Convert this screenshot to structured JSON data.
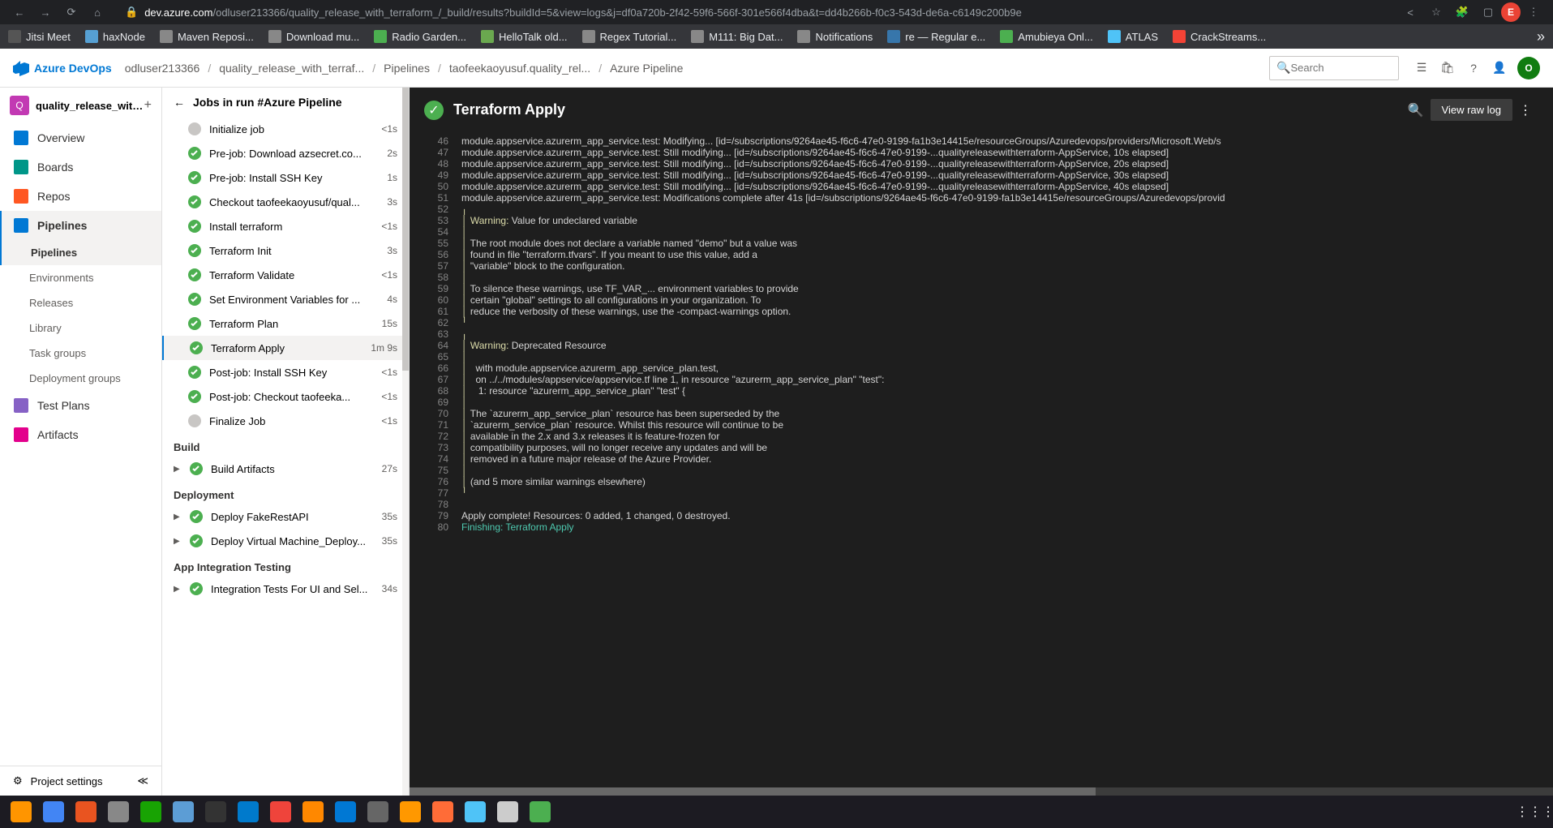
{
  "browser": {
    "url_host": "dev.azure.com",
    "url_path": "/odluser213366/quality_release_with_terraform_/_build/results?buildId=5&view=logs&j=df0a720b-2f42-59f6-566f-301e566f4dba&t=dd4b266b-f0c3-543d-de6a-c6149c200b9e",
    "avatar_letter": "E"
  },
  "bookmarks": [
    {
      "label": "Jitsi Meet",
      "color": "#555"
    },
    {
      "label": "haxNode",
      "color": "#56a0d3"
    },
    {
      "label": "Maven Reposi...",
      "color": "#888"
    },
    {
      "label": "Download mu...",
      "color": "#888"
    },
    {
      "label": "Radio Garden...",
      "color": "#4caf50"
    },
    {
      "label": "HelloTalk old...",
      "color": "#6aa84f"
    },
    {
      "label": "Regex Tutorial...",
      "color": "#888"
    },
    {
      "label": "M111: Big Dat...",
      "color": "#888"
    },
    {
      "label": "Notifications",
      "color": "#888"
    },
    {
      "label": "re — Regular e...",
      "color": "#3776ab"
    },
    {
      "label": "Amubieya Onl...",
      "color": "#4caf50"
    },
    {
      "label": "ATLAS",
      "color": "#4fc3f7"
    },
    {
      "label": "CrackStreams...",
      "color": "#f44336"
    }
  ],
  "azure": {
    "product": "Azure DevOps",
    "breadcrumbs": [
      "odluser213366",
      "quality_release_with_terraf...",
      "Pipelines",
      "taofeekaoyusuf.quality_rel...",
      "Azure Pipeline"
    ],
    "search_placeholder": "Search",
    "avatar_letter": "O"
  },
  "sidebar": {
    "project_name": "quality_release_with_t...",
    "items": [
      {
        "label": "Overview",
        "icon": "grid",
        "color": "#0078d4"
      },
      {
        "label": "Boards",
        "icon": "board",
        "color": "#009688"
      },
      {
        "label": "Repos",
        "icon": "repo",
        "color": "#ff5722"
      },
      {
        "label": "Pipelines",
        "icon": "pipeline",
        "color": "#0078d4",
        "active": true
      }
    ],
    "pipeline_subs": [
      {
        "label": "Pipelines",
        "active": true
      },
      {
        "label": "Environments"
      },
      {
        "label": "Releases"
      },
      {
        "label": "Library"
      },
      {
        "label": "Task groups"
      },
      {
        "label": "Deployment groups"
      }
    ],
    "bottom_items": [
      {
        "label": "Test Plans",
        "icon": "flask",
        "color": "#8661c5"
      },
      {
        "label": "Artifacts",
        "icon": "artifact",
        "color": "#e3008c"
      }
    ],
    "settings_label": "Project settings"
  },
  "jobs": {
    "header": "Jobs in run #Azure Pipeline",
    "list": [
      {
        "name": "Initialize job",
        "status": "neutral",
        "time": "<1s"
      },
      {
        "name": "Pre-job: Download azsecret.co...",
        "status": "success",
        "time": "2s"
      },
      {
        "name": "Pre-job: Install SSH Key",
        "status": "success",
        "time": "1s"
      },
      {
        "name": "Checkout taofeekaoyusuf/qual...",
        "status": "success",
        "time": "3s"
      },
      {
        "name": "Install terraform",
        "status": "success",
        "time": "<1s"
      },
      {
        "name": "Terraform Init",
        "status": "success",
        "time": "3s"
      },
      {
        "name": "Terraform Validate",
        "status": "success",
        "time": "<1s"
      },
      {
        "name": "Set Environment Variables for ...",
        "status": "success",
        "time": "4s"
      },
      {
        "name": "Terraform Plan",
        "status": "success",
        "time": "15s"
      },
      {
        "name": "Terraform Apply",
        "status": "success",
        "time": "1m 9s",
        "selected": true
      },
      {
        "name": "Post-job: Install SSH Key",
        "status": "success",
        "time": "<1s"
      },
      {
        "name": "Post-job: Checkout taofeeka...",
        "status": "success",
        "time": "<1s"
      },
      {
        "name": "Finalize Job",
        "status": "neutral",
        "time": "<1s"
      }
    ],
    "groups": [
      {
        "label": "Build",
        "items": [
          {
            "name": "Build Artifacts",
            "status": "success",
            "time": "27s",
            "chevron": true
          }
        ]
      },
      {
        "label": "Deployment",
        "items": [
          {
            "name": "Deploy FakeRestAPI",
            "status": "success",
            "time": "35s",
            "chevron": true
          },
          {
            "name": "Deploy Virtual Machine_Deploy...",
            "status": "success",
            "time": "35s",
            "chevron": true
          }
        ]
      },
      {
        "label": "App Integration Testing",
        "items": [
          {
            "name": "Integration Tests For UI and Sel...",
            "status": "success",
            "time": "34s",
            "chevron": true
          }
        ]
      }
    ]
  },
  "log": {
    "title": "Terraform Apply",
    "raw_button": "View raw log",
    "lines": [
      {
        "n": 46,
        "text": "module.appservice.azurerm_app_service.test: Modifying... [id=/subscriptions/9264ae45-f6c6-47e0-9199-fa1b3e14415e/resourceGroups/Azuredevops/providers/Microsoft.Web/s"
      },
      {
        "n": 47,
        "text": "module.appservice.azurerm_app_service.test: Still modifying... [id=/subscriptions/9264ae45-f6c6-47e0-9199-...qualityreleasewithterraform-AppService, 10s elapsed]"
      },
      {
        "n": 48,
        "text": "module.appservice.azurerm_app_service.test: Still modifying... [id=/subscriptions/9264ae45-f6c6-47e0-9199-...qualityreleasewithterraform-AppService, 20s elapsed]"
      },
      {
        "n": 49,
        "text": "module.appservice.azurerm_app_service.test: Still modifying... [id=/subscriptions/9264ae45-f6c6-47e0-9199-...qualityreleasewithterraform-AppService, 30s elapsed]"
      },
      {
        "n": 50,
        "text": "module.appservice.azurerm_app_service.test: Still modifying... [id=/subscriptions/9264ae45-f6c6-47e0-9199-...qualityreleasewithterraform-AppService, 40s elapsed]"
      },
      {
        "n": 51,
        "text": "module.appservice.azurerm_app_service.test: Modifications complete after 41s [id=/subscriptions/9264ae45-f6c6-47e0-9199-fa1b3e14415e/resourceGroups/Azuredevops/provid"
      },
      {
        "n": 52,
        "text": "╷",
        "cls": "log-yellow"
      },
      {
        "n": 53,
        "html": "<span class='log-yellow'>│ </span><span class='log-yellow'>Warning:</span><span class='log-white'> Value for undeclared variable</span>"
      },
      {
        "n": 54,
        "text": "│ ",
        "cls": "log-yellow"
      },
      {
        "n": 55,
        "html": "<span class='log-yellow'>│ </span>The root module does not declare a variable named \"demo\" but a value was"
      },
      {
        "n": 56,
        "html": "<span class='log-yellow'>│ </span>found in file \"terraform.tfvars\". If you meant to use this value, add a"
      },
      {
        "n": 57,
        "html": "<span class='log-yellow'>│ </span>\"variable\" block to the configuration."
      },
      {
        "n": 58,
        "text": "│ ",
        "cls": "log-yellow"
      },
      {
        "n": 59,
        "html": "<span class='log-yellow'>│ </span>To silence these warnings, use TF_VAR_... environment variables to provide"
      },
      {
        "n": 60,
        "html": "<span class='log-yellow'>│ </span>certain \"global\" settings to all configurations in your organization. To"
      },
      {
        "n": 61,
        "html": "<span class='log-yellow'>│ </span>reduce the verbosity of these warnings, use the -compact-warnings option."
      },
      {
        "n": 62,
        "text": "╵",
        "cls": "log-yellow"
      },
      {
        "n": 63,
        "text": "╷",
        "cls": "log-yellow"
      },
      {
        "n": 64,
        "html": "<span class='log-yellow'>│ </span><span class='log-yellow'>Warning:</span><span class='log-white'> Deprecated Resource</span>"
      },
      {
        "n": 65,
        "text": "│ ",
        "cls": "log-yellow"
      },
      {
        "n": 66,
        "html": "<span class='log-yellow'>│ </span>  with module.appservice.azurerm_app_service_plan.test,"
      },
      {
        "n": 67,
        "html": "<span class='log-yellow'>│ </span>  on ../../modules/appservice/appservice.tf line 1, in resource \"azurerm_app_service_plan\" \"test\":"
      },
      {
        "n": 68,
        "html": "<span class='log-yellow'>│ </span>   1: resource \"azurerm_app_service_plan\" \"test\" {"
      },
      {
        "n": 69,
        "text": "│ ",
        "cls": "log-yellow"
      },
      {
        "n": 70,
        "html": "<span class='log-yellow'>│ </span>The `azurerm_app_service_plan` resource has been superseded by the"
      },
      {
        "n": 71,
        "html": "<span class='log-yellow'>│ </span>`azurerm_service_plan` resource. Whilst this resource will continue to be"
      },
      {
        "n": 72,
        "html": "<span class='log-yellow'>│ </span>available in the 2.x and 3.x releases it is feature-frozen for"
      },
      {
        "n": 73,
        "html": "<span class='log-yellow'>│ </span>compatibility purposes, will no longer receive any updates and will be"
      },
      {
        "n": 74,
        "html": "<span class='log-yellow'>│ </span>removed in a future major release of the Azure Provider."
      },
      {
        "n": 75,
        "text": "│ ",
        "cls": "log-yellow"
      },
      {
        "n": 76,
        "html": "<span class='log-yellow'>│ </span>(and 5 more similar warnings elsewhere)"
      },
      {
        "n": 77,
        "text": "╵",
        "cls": "log-yellow"
      },
      {
        "n": 78,
        "text": ""
      },
      {
        "n": 79,
        "text": "Apply complete! Resources: 0 added, 1 changed, 0 destroyed."
      },
      {
        "n": 80,
        "html": "<span class='log-cyan'>Finishing: Terraform Apply</span>"
      }
    ]
  },
  "taskbar": {
    "apps": [
      "firefox",
      "chrome",
      "ubuntu",
      "files",
      "libre",
      "note",
      "terminal",
      "vscode",
      "anydesk",
      "vlc",
      "blue1",
      "grid",
      "sublime",
      "postman",
      "blue2",
      "blank",
      "calc"
    ]
  }
}
